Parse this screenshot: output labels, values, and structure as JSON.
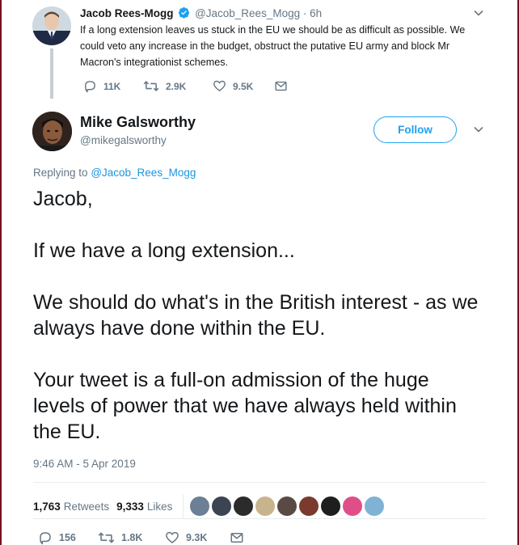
{
  "parent_tweet": {
    "name": "Jacob Rees-Mogg",
    "handle": "@Jacob_Rees_Mogg",
    "separator": "·",
    "time": "6h",
    "text": "If a long extension leaves us stuck in the EU we should be as difficult as possible. We could veto any increase in the budget, obstruct the putative EU army and block Mr Macron's integrationist schemes.",
    "actions": {
      "replies": "11K",
      "retweets": "2.9K",
      "likes": "9.5K"
    },
    "verified": true
  },
  "main_tweet": {
    "name": "Mike Galsworthy",
    "handle": "@mikegalsworthy",
    "follow_label": "Follow",
    "replying_prefix": "Replying to",
    "replying_to": "@Jacob_Rees_Mogg",
    "body": [
      "Jacob,",
      "If we have a long extension...",
      "We should do what's in the British interest - as we always have done within the EU.",
      "Your tweet is a full-on admission of the huge levels of power that we have always held within the EU."
    ],
    "timestamp": "9:46 AM - 5 Apr 2019",
    "stats": {
      "retweets_count": "1,763",
      "retweets_label": "Retweets",
      "likes_count": "9,333",
      "likes_label": "Likes"
    },
    "liker_avatar_colors": [
      "#6b7f95",
      "#3c4452",
      "#2b2b2b",
      "#c8b48c",
      "#5a4a44",
      "#7a3b2e",
      "#1e1e1e",
      "#e04e8a",
      "#7fb2d4"
    ],
    "actions": {
      "replies": "156",
      "retweets": "1.8K",
      "likes": "9.3K"
    }
  },
  "colors": {
    "accent": "#1da1f2",
    "link": "#1b95e0",
    "muted": "#657786",
    "text": "#14171a",
    "window_edge": "#7a1020"
  },
  "icons": [
    "verified-badge-icon",
    "chevron-down-icon",
    "reply-icon",
    "retweet-icon",
    "like-icon",
    "direct-message-icon"
  ]
}
